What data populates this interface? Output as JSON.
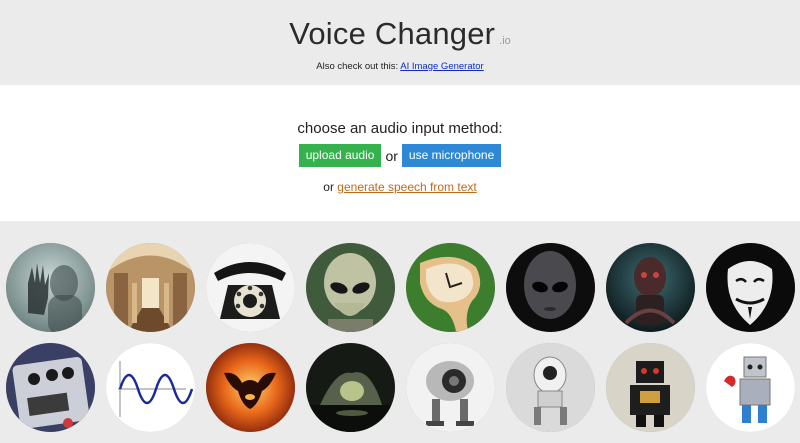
{
  "header": {
    "title": "Voice Changer",
    "suffix": ".io",
    "also_prefix": "Also check out this:",
    "also_link": "AI Image Generator"
  },
  "panel": {
    "choose": "choose an audio input method:",
    "upload_label": "upload audio",
    "or1": "or",
    "mic_label": "use microphone",
    "or2": "or",
    "tts_link": "generate speech from text"
  },
  "colors": {
    "upload_button": "#35b24e",
    "mic_button": "#2e88d6",
    "link_blue": "#0b2fc0",
    "link_orange": "#c16a1b",
    "background": "#ebebeb"
  },
  "voices_row1": [
    "ghost",
    "church",
    "telephone",
    "alien",
    "melting-clock",
    "dark-alien",
    "cyborg",
    "anonymous-mask"
  ],
  "voices_row2": [
    "guitar-pedal",
    "sine-wave",
    "fire-demon",
    "cave",
    "robot-eye",
    "white-robot",
    "tin-robot",
    "toy-robot"
  ]
}
